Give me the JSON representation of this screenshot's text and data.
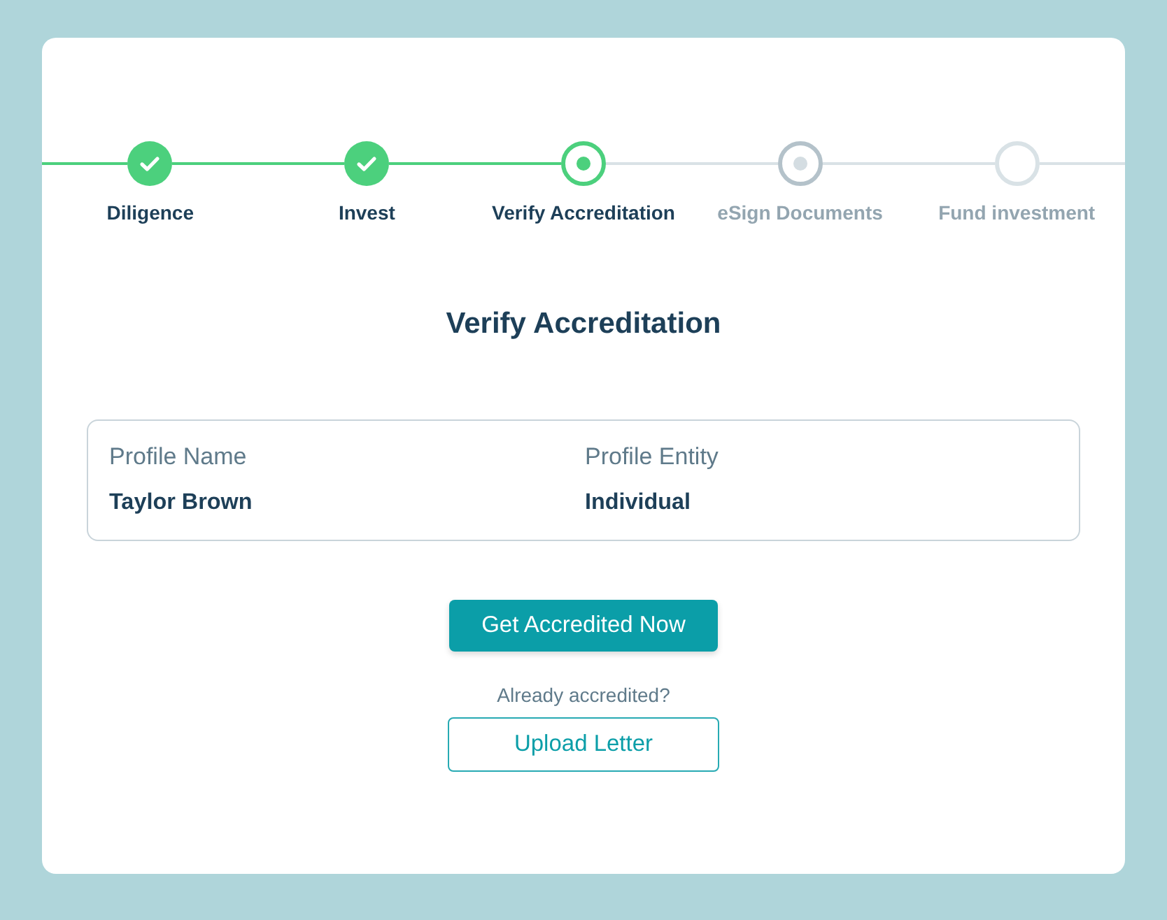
{
  "steps": [
    {
      "label": "Diligence",
      "kind": "complete"
    },
    {
      "label": "Invest",
      "kind": "complete"
    },
    {
      "label": "Verify Accreditation",
      "kind": "current"
    },
    {
      "label": "eSign Documents",
      "kind": "pending"
    },
    {
      "label": "Fund investment",
      "kind": "upcoming"
    }
  ],
  "title": "Verify Accreditation",
  "profile": {
    "fields": [
      {
        "label": "Profile Name",
        "value": "Taylor Brown"
      },
      {
        "label": "Profile Entity",
        "value": "Individual"
      }
    ]
  },
  "primary_button": "Get Accredited Now",
  "prompt": "Already accredited?",
  "secondary_button": "Upload Letter"
}
